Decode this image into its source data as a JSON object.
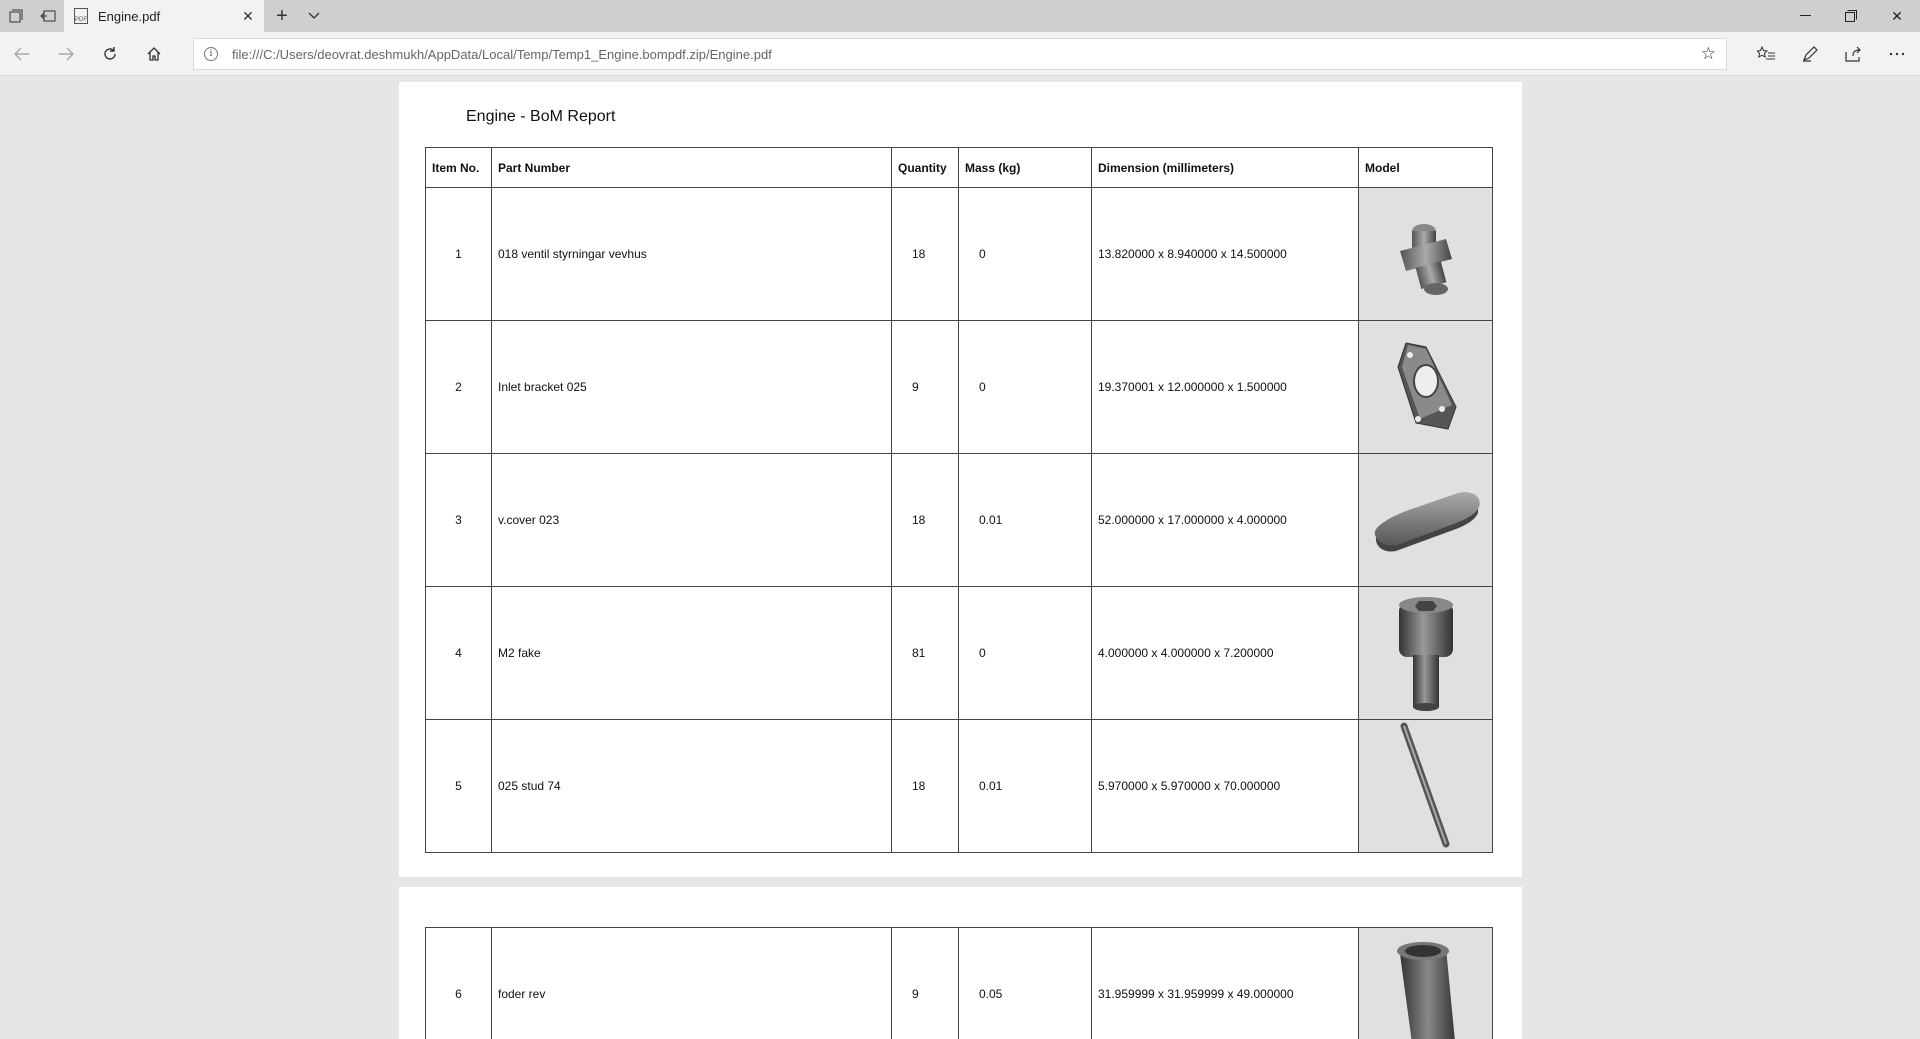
{
  "browser": {
    "tab_title": "Engine.pdf",
    "address_url": "file:///C:/Users/deovrat.deshmukh/AppData/Local/Temp/Temp1_Engine.bompdf.zip/Engine.pdf",
    "pdf_icon_text": "PDF"
  },
  "report": {
    "title": "Engine - BoM Report",
    "headers": {
      "item_no": "Item No.",
      "part_number": "Part Number",
      "quantity": "Quantity",
      "mass": "Mass (kg)",
      "dimension": "Dimension (millimeters)",
      "model": "Model"
    },
    "rows": [
      {
        "item": "1",
        "part": "018 ventil styrningar vevhus",
        "qty": "18",
        "mass": "0",
        "dim": "13.820000 x 8.940000 x 14.500000",
        "model_icon": "valve-guide-housing-icon"
      },
      {
        "item": "2",
        "part": "Inlet bracket 025",
        "qty": "9",
        "mass": "0",
        "dim": "19.370001 x 12.000000 x 1.500000",
        "model_icon": "bracket-plate-icon"
      },
      {
        "item": "3",
        "part": "v.cover 023",
        "qty": "18",
        "mass": "0.01",
        "dim": "52.000000 x 17.000000 x 4.000000",
        "model_icon": "oval-cover-icon"
      },
      {
        "item": "4",
        "part": "M2 fake",
        "qty": "81",
        "mass": "0",
        "dim": "4.000000 x 4.000000 x 7.200000",
        "model_icon": "socket-screw-icon"
      },
      {
        "item": "5",
        "part": "025 stud 74",
        "qty": "18",
        "mass": "0.01",
        "dim": "5.970000 x 5.970000 x 70.000000",
        "model_icon": "stud-rod-icon"
      },
      {
        "item": "6",
        "part": "foder rev",
        "qty": "9",
        "mass": "0.05",
        "dim": "31.959999 x 31.959999 x 49.000000",
        "model_icon": "liner-tube-icon"
      }
    ]
  }
}
